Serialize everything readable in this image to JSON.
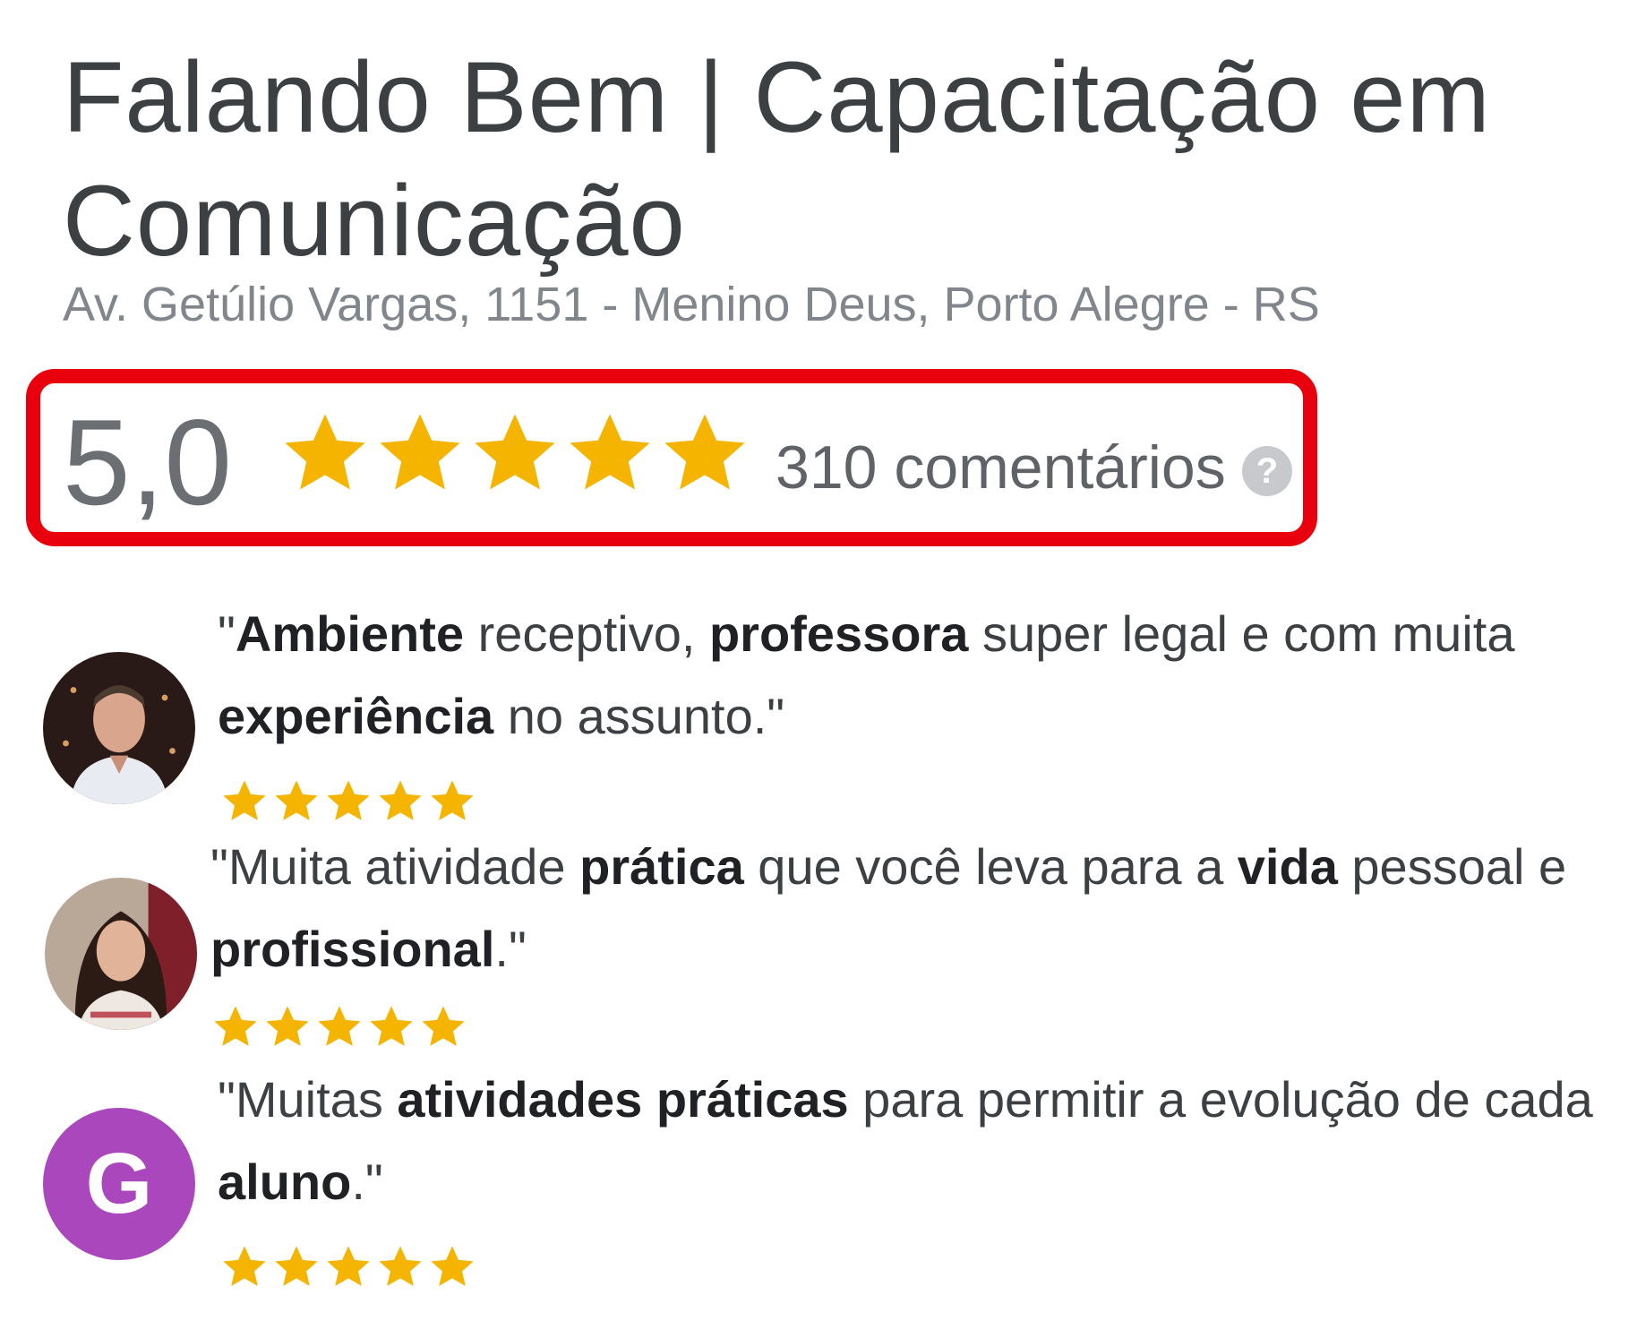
{
  "business": {
    "name": "Falando Bem | Capacitação em Comunicação",
    "address": "Av. Getúlio Vargas, 1151 - Menino Deus, Porto Alegre - RS"
  },
  "rating": {
    "value": "5,0",
    "stars": 5,
    "review_count": "310 comentários",
    "help_icon": "?"
  },
  "reviews": [
    {
      "avatar": "photo-man",
      "stars": 5,
      "quote": [
        {
          "t": "\"",
          "b": false
        },
        {
          "t": "Ambiente",
          "b": true
        },
        {
          "t": " receptivo, ",
          "b": false
        },
        {
          "t": "professora",
          "b": true
        },
        {
          "t": " super legal e com muita ",
          "b": false
        },
        {
          "t": "experiência",
          "b": true
        },
        {
          "t": " no assunto.\"",
          "b": false
        }
      ]
    },
    {
      "avatar": "photo-woman",
      "stars": 5,
      "quote": [
        {
          "t": "\"Muita atividade ",
          "b": false
        },
        {
          "t": "prática",
          "b": true
        },
        {
          "t": " que você leva para a ",
          "b": false
        },
        {
          "t": "vida",
          "b": true
        },
        {
          "t": " pessoal e ",
          "b": false
        },
        {
          "t": "profissional",
          "b": true
        },
        {
          "t": ".\"",
          "b": false
        }
      ]
    },
    {
      "avatar_letter": "G",
      "stars": 5,
      "quote": [
        {
          "t": "\"Muitas ",
          "b": false
        },
        {
          "t": "atividades práticas",
          "b": true
        },
        {
          "t": " para permitir a evolução de cada ",
          "b": false
        },
        {
          "t": "aluno",
          "b": true
        },
        {
          "t": ".\"",
          "b": false
        }
      ]
    }
  ],
  "colors": {
    "star": "#f4b400",
    "highlight_border": "#e8000c",
    "avatar_g": "#ab47bc"
  }
}
